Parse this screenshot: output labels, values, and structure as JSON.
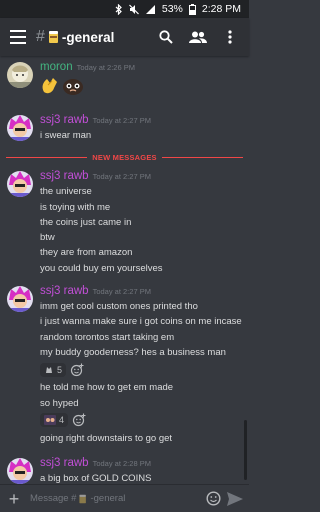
{
  "status_bar": {
    "battery": "53%",
    "time": "2:28 PM"
  },
  "header": {
    "hash": "#",
    "title": "-general"
  },
  "new_messages_label": "NEW MESSAGES",
  "groups": [
    {
      "author": "moron",
      "author_color": "#43b581",
      "timestamp": "Today at 2:26 PM",
      "lines": []
    },
    {
      "author": "ssj3 rawb",
      "author_color": "#c14fd6",
      "timestamp": "Today at 2:27 PM",
      "lines": [
        "i swear man"
      ]
    },
    {
      "author": "ssj3 rawb",
      "author_color": "#c14fd6",
      "timestamp": "Today at 2:27 PM",
      "lines": [
        "the universe",
        "is toying with me",
        "the coins just came in",
        "btw",
        "they are from amazon",
        "you could buy em yourselves"
      ]
    },
    {
      "author": "ssj3 rawb",
      "author_color": "#c14fd6",
      "timestamp": "Today at 2:27 PM",
      "lines_a": [
        "imm get cool custom ones printed tho",
        "i just wanna make sure i got coins on me incase",
        "random torontos start taking em",
        "my buddy gooderness? hes a business man"
      ],
      "reaction_a_count": "5",
      "lines_b": [
        "he told me how to get em made",
        "so hyped"
      ],
      "reaction_b_count": "4",
      "lines_c": [
        "going right downstairs to go get"
      ]
    },
    {
      "author": "ssj3 rawb",
      "author_color": "#c14fd6",
      "timestamp": "Today at 2:28 PM",
      "lines": [
        "a big box of GOLD COINS"
      ]
    }
  ],
  "input": {
    "placeholder_prefix": "Message #",
    "placeholder_channel": "-general"
  },
  "icons": [
    "hamburger-icon",
    "search-icon",
    "members-icon",
    "more-icon",
    "plus-icon",
    "emoji-icon",
    "send-icon",
    "wave-emoji",
    "clap-emoji",
    "thinking-emoji",
    "reaction-emoji"
  ],
  "colors": {
    "background": "#36393f",
    "header": "#2f3136",
    "new_messages": "#f04747",
    "moron": "#43b581",
    "ssj3_rawb": "#c14fd6"
  }
}
